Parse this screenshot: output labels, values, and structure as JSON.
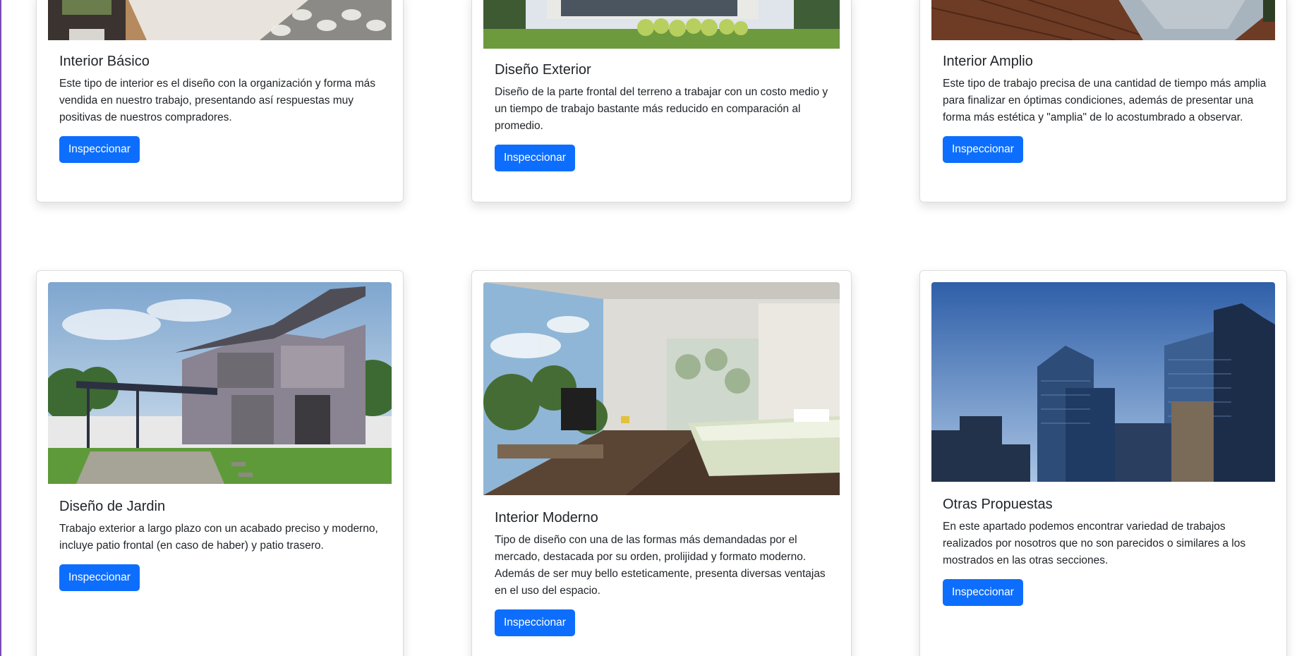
{
  "cards": [
    {
      "title": "Interior Básico",
      "text": "Este tipo de interior es el diseño con la organización y forma más vendida en nuestro trabajo, presentando así respuestas muy positivas de nuestros compradores.",
      "button": "Inspeccionar",
      "image_icon": "living-room-photo"
    },
    {
      "title": "Diseño Exterior",
      "text": "Diseño de la parte frontal del terreno a trabajar con un costo medio y un tiempo de trabajo bastante más reducido en comparación al promedio.",
      "button": "Inspeccionar",
      "image_icon": "house-exterior-photo"
    },
    {
      "title": "Interior Amplio",
      "text": "Este tipo de trabajo precisa de una cantidad de tiempo más amplia para finalizar en óptimas condiciones, además de presentar una forma más estética y \"amplia\" de lo acostumbrado a observar.",
      "button": "Inspeccionar",
      "image_icon": "wood-floor-photo"
    },
    {
      "title": "Diseño de Jardin",
      "text": "Trabajo exterior a largo plazo con un acabado preciso y moderno, incluye patio frontal (en caso de haber) y patio trasero.",
      "button": "Inspeccionar",
      "image_icon": "house-garden-photo"
    },
    {
      "title": "Interior Moderno",
      "text": "Tipo de diseño con una de las formas más demandadas por el mercado, destacada por su orden, prolijidad y formato moderno. Además de ser muy bello esteticamente, presenta diversas ventajas en el uso del espacio.",
      "button": "Inspeccionar",
      "image_icon": "modern-bedroom-photo"
    },
    {
      "title": "Otras Propuestas",
      "text": "En este apartado podemos encontrar variedad de trabajos realizados por nosotros que no son parecidos o similares a los mostrados en las otras secciones.",
      "button": "Inspeccionar",
      "image_icon": "skyscrapers-photo"
    }
  ],
  "colors": {
    "button": "#0d6efd",
    "page_left_accent": "#7b4bb5"
  }
}
